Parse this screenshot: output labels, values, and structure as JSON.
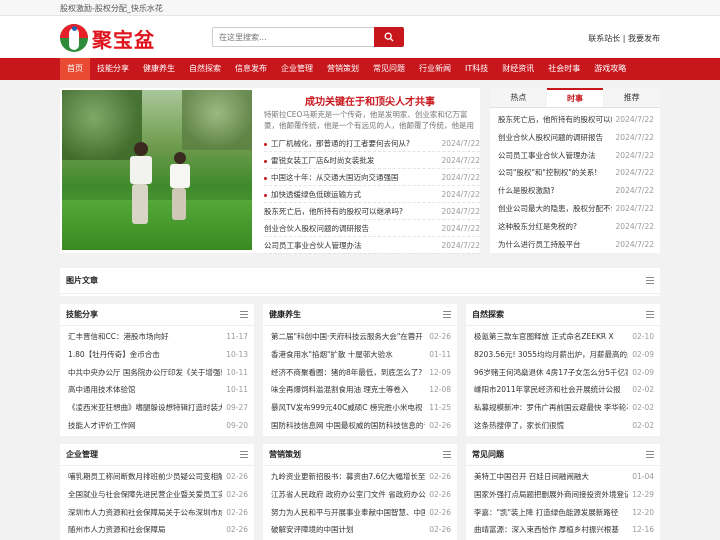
{
  "topbar": {
    "text": "股权激励-股权分配_快乐水花"
  },
  "header": {
    "logo_text": "聚宝盆",
    "search_placeholder": "在这里搜索...",
    "links": "联系站长 | 我要发布"
  },
  "nav": [
    "首页",
    "技能分享",
    "健康养生",
    "自然探索",
    "信息发布",
    "企业管理",
    "营销策划",
    "常见问题",
    "行业新闻",
    "IT科技",
    "财经资讯",
    "社会时事",
    "游戏攻略"
  ],
  "hero": {
    "title": "成功关键在于和顶尖人才共事",
    "summary": "特斯拉CEO马斯克是一个传奇，他是发明家、创业家和亿万富豪，他颠覆传统，他是一个有远见的人，他颠覆了传统，他是用自己的智慧改变世界的科技狂人\"......",
    "items": [
      {
        "title": "工厂机械化，那普通的打工者要何去何从?",
        "date": "2024/7/22"
      },
      {
        "title": "雷锐女装工厂店&时尚女装批发",
        "date": "2024/7/22"
      },
      {
        "title": "中国这十年：从交通大国迈向交通强国",
        "date": "2024/7/22"
      },
      {
        "title": "加快透缓绿色低碳运输方式",
        "date": "2024/7/22"
      },
      {
        "title": "股东死亡后，他所持有的股权可以继承吗?",
        "date": "2024/7/22"
      },
      {
        "title": "创业合伙人股权问题的调研报告",
        "date": "2024/7/22"
      },
      {
        "title": "公司员工事业合伙人管理办法",
        "date": "2024/7/22"
      }
    ]
  },
  "tabs": {
    "labels": [
      "热点",
      "时事",
      "推荐"
    ],
    "items": [
      {
        "title": "股东死亡后，他所持有的股权可以继承吗?",
        "date": "2024/7/22"
      },
      {
        "title": "创业合伙人股权问题的调研报告",
        "date": "2024/7/22"
      },
      {
        "title": "公司员工事业合伙人管理办法",
        "date": "2024/7/22"
      },
      {
        "title": "公司\"股权\"和\"控制权\"的关系!",
        "date": "2024/7/22"
      },
      {
        "title": "什么是股权激励?",
        "date": "2024/7/22"
      },
      {
        "title": "创业公司最大的隐患，股权分配不公",
        "date": "2024/7/22"
      },
      {
        "title": "这种股东分红是免税的?",
        "date": "2024/7/22"
      },
      {
        "title": "为什么进行员工持股平台",
        "date": "2024/7/22"
      }
    ]
  },
  "pic_section": {
    "title": "图片文章"
  },
  "cards": [
    {
      "title": "技能分享",
      "items": [
        {
          "title": "汇丰晋信和CC：港股市场向好",
          "date": "11-17"
        },
        {
          "title": "1.80【牡丹传奇】金币合击",
          "date": "10-13"
        },
        {
          "title": "中共中央办公厅 国务院办公厅印发《关于增强新",
          "date": "10-11"
        },
        {
          "title": "高中通用技术体验馆",
          "date": "10-11"
        },
        {
          "title": "《凌西米亚狂想曲》嗜腿躲设想特辑打造时装大",
          "date": "09-27"
        },
        {
          "title": "技能人才评价工作网",
          "date": "09-20"
        }
      ]
    },
    {
      "title": "健康养生",
      "items": [
        {
          "title": "第二届\"科创中国·天府科技云服务大会\"在蓉开",
          "date": "02-26"
        },
        {
          "title": "香港食用水\"掐烟\"扩散 十屋邨大验水",
          "date": "01-11"
        },
        {
          "title": "经济不商聚看圈：猪的8年最低，到底怎么了?",
          "date": "12-09"
        },
        {
          "title": "味全再爆饲料滥混割食用油 理克士等卷入",
          "date": "12-08"
        },
        {
          "title": "暴风TV发布999元40C威硕C 榜完胜小米电视",
          "date": "11-25"
        },
        {
          "title": "国防科技信息网 中国最权威的国防科技信息的专",
          "date": "02-26"
        }
      ]
    },
    {
      "title": "自然探索",
      "items": [
        {
          "title": "极氪第三款车官图释放 正式命名ZEEKR X",
          "date": "02-10"
        },
        {
          "title": "8203.56元! 3055均均月薪出炉，月薪最高的是",
          "date": "02-09"
        },
        {
          "title": "96岁赌王何鸿燊退休 4房17子女怎么分5千亿家",
          "date": "02-09"
        },
        {
          "title": "嵊阳市2011年掌民经济和社会开展统计公报",
          "date": "02-02"
        },
        {
          "title": "私募规模新冲：罗伟广再前国云避最快 李华轮石波",
          "date": "02-02"
        },
        {
          "title": "这条热搜停了，家长们很慌",
          "date": "02-02"
        }
      ]
    },
    {
      "title": "企业管理",
      "items": [
        {
          "title": "哺乳期员工称间断数月排班前少员疑公司变相解",
          "date": "02-26"
        },
        {
          "title": "全国就业与社会保障先进民营企业暨关爱员工实",
          "date": "02-26"
        },
        {
          "title": "深圳市人力资源和社会保障局关于公布深圳市成",
          "date": "02-26"
        },
        {
          "title": "随州市人力资源和社会保障局",
          "date": "02-26"
        }
      ]
    },
    {
      "title": "营销策划",
      "items": [
        {
          "title": "九岭资业更新招股书：募资由7.6亿大幅增长至3",
          "date": "02-26"
        },
        {
          "title": "江苏省人民政府 政府办公室门文件 省政府办公",
          "date": "02-26"
        },
        {
          "title": "努力为人民和平与开展事业奉献中国智慧、中国",
          "date": "02-26"
        },
        {
          "title": "破解安评障境的中国计划",
          "date": "02-26"
        }
      ]
    },
    {
      "title": "常见问题",
      "items": [
        {
          "title": "美特工中国召开 召娃日间融闹融大",
          "date": "01-04"
        },
        {
          "title": "国家外强打点局题把删展外商间接投资外境登记",
          "date": "12-29"
        },
        {
          "title": "李嘉：\"凯\"装上降 打造绿色能源发展新路径",
          "date": "12-20"
        },
        {
          "title": "曲靖富源：深入束西恰作 厚植乡村振兴根基",
          "date": "12-16"
        }
      ]
    }
  ]
}
